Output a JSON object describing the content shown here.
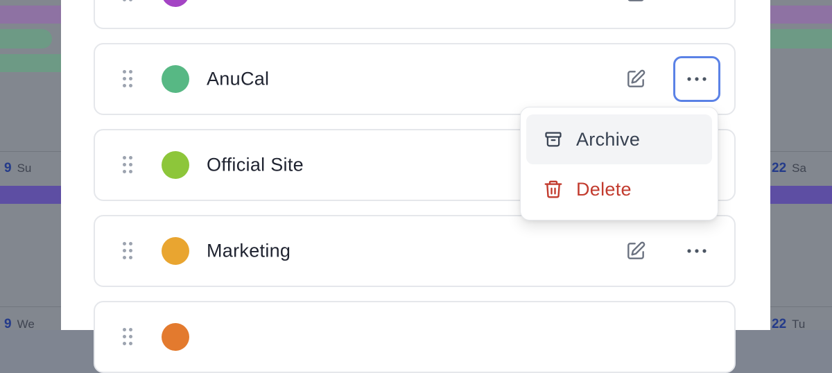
{
  "background": {
    "days": [
      {
        "num": "9",
        "dow": "Su"
      },
      {
        "num": "22",
        "dow": "Sa"
      },
      {
        "num": "9",
        "dow": "We"
      },
      {
        "num": "22",
        "dow": "Tu"
      }
    ]
  },
  "calendars": [
    {
      "name": "",
      "color": "#a444c4"
    },
    {
      "name": "AnuCal",
      "color": "#57b884"
    },
    {
      "name": "Official Site",
      "color": "#8dc63a"
    },
    {
      "name": "Marketing",
      "color": "#e9a530"
    },
    {
      "name": "",
      "color": "#e37a2e"
    }
  ],
  "menu": {
    "archive_label": "Archive",
    "delete_label": "Delete",
    "delete_color": "#c23b2e"
  },
  "colors": {
    "focus_ring": "#5b82e6"
  }
}
